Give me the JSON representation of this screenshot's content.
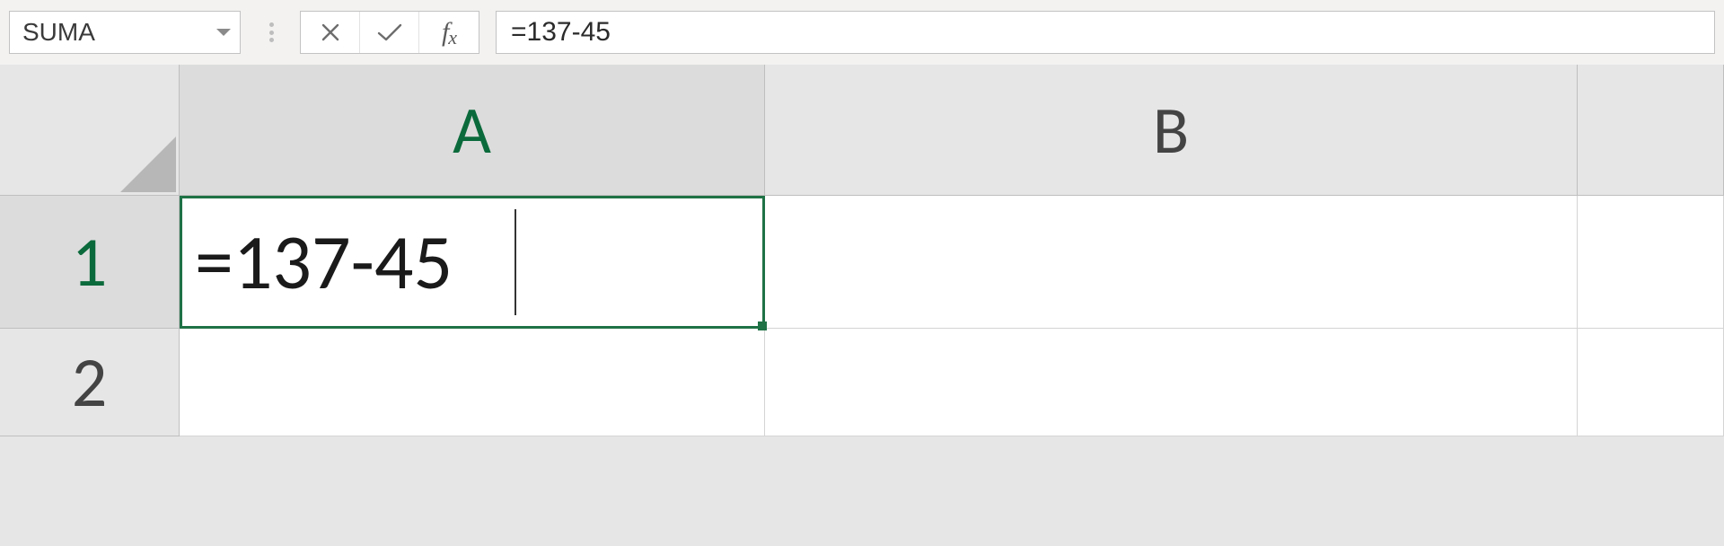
{
  "name_box": {
    "value": "SUMA"
  },
  "formula_bar": {
    "value": "=137-45"
  },
  "columns": [
    "A",
    "B",
    ""
  ],
  "rows": [
    "1",
    "2"
  ],
  "active_cell": {
    "row": 0,
    "col": 0,
    "editing_value": "=137-45"
  }
}
